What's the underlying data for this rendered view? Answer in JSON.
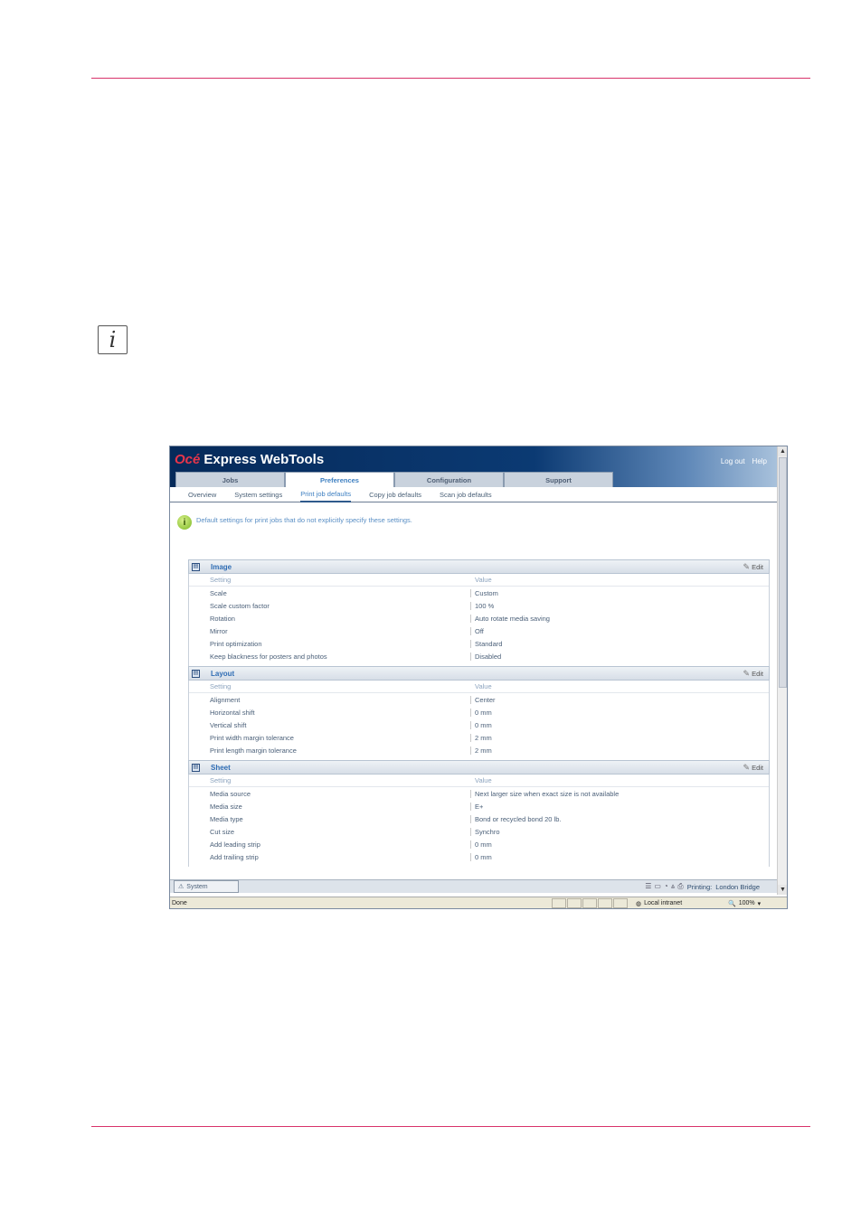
{
  "app": {
    "brand": "Océ",
    "title": "Express WebTools",
    "links": {
      "logout": "Log out",
      "help": "Help"
    }
  },
  "tabs": [
    "Jobs",
    "Preferences",
    "Configuration",
    "Support"
  ],
  "subnav": [
    "Overview",
    "System settings",
    "Print job defaults",
    "Copy job defaults",
    "Scan job defaults"
  ],
  "info_text": "Default settings for print jobs that do not explicitly specify these settings.",
  "col_headers": {
    "setting": "Setting",
    "value": "Value"
  },
  "edit_label": "Edit",
  "sections": [
    {
      "title": "Image",
      "rows": [
        {
          "k": "Scale",
          "v": "Custom"
        },
        {
          "k": "Scale custom factor",
          "v": "100 %"
        },
        {
          "k": "Rotation",
          "v": "Auto rotate media saving"
        },
        {
          "k": "Mirror",
          "v": "Off"
        },
        {
          "k": "Print optimization",
          "v": "Standard"
        },
        {
          "k": "Keep blackness for posters and photos",
          "v": "Disabled"
        }
      ]
    },
    {
      "title": "Layout",
      "rows": [
        {
          "k": "Alignment",
          "v": "Center"
        },
        {
          "k": "Horizontal shift",
          "v": "0 mm"
        },
        {
          "k": "Vertical shift",
          "v": "0 mm"
        },
        {
          "k": "Print width margin tolerance",
          "v": "2 mm"
        },
        {
          "k": "Print length margin tolerance",
          "v": "2 mm"
        }
      ]
    },
    {
      "title": "Sheet",
      "rows": [
        {
          "k": "Media source",
          "v": "Next larger size when exact size is not available"
        },
        {
          "k": "Media size",
          "v": "E+"
        },
        {
          "k": "Media type",
          "v": "Bond or recycled bond 20 lb."
        },
        {
          "k": "Cut size",
          "v": "Synchro"
        },
        {
          "k": "Add leading strip",
          "v": "0 mm"
        },
        {
          "k": "Add trailing strip",
          "v": "0 mm"
        }
      ]
    }
  ],
  "status": {
    "system_tab": "System",
    "printing_label": "Printing:",
    "printer": "London Bridge"
  },
  "browser": {
    "done": "Done",
    "zone": "Local intranet",
    "zoom": "100%"
  }
}
